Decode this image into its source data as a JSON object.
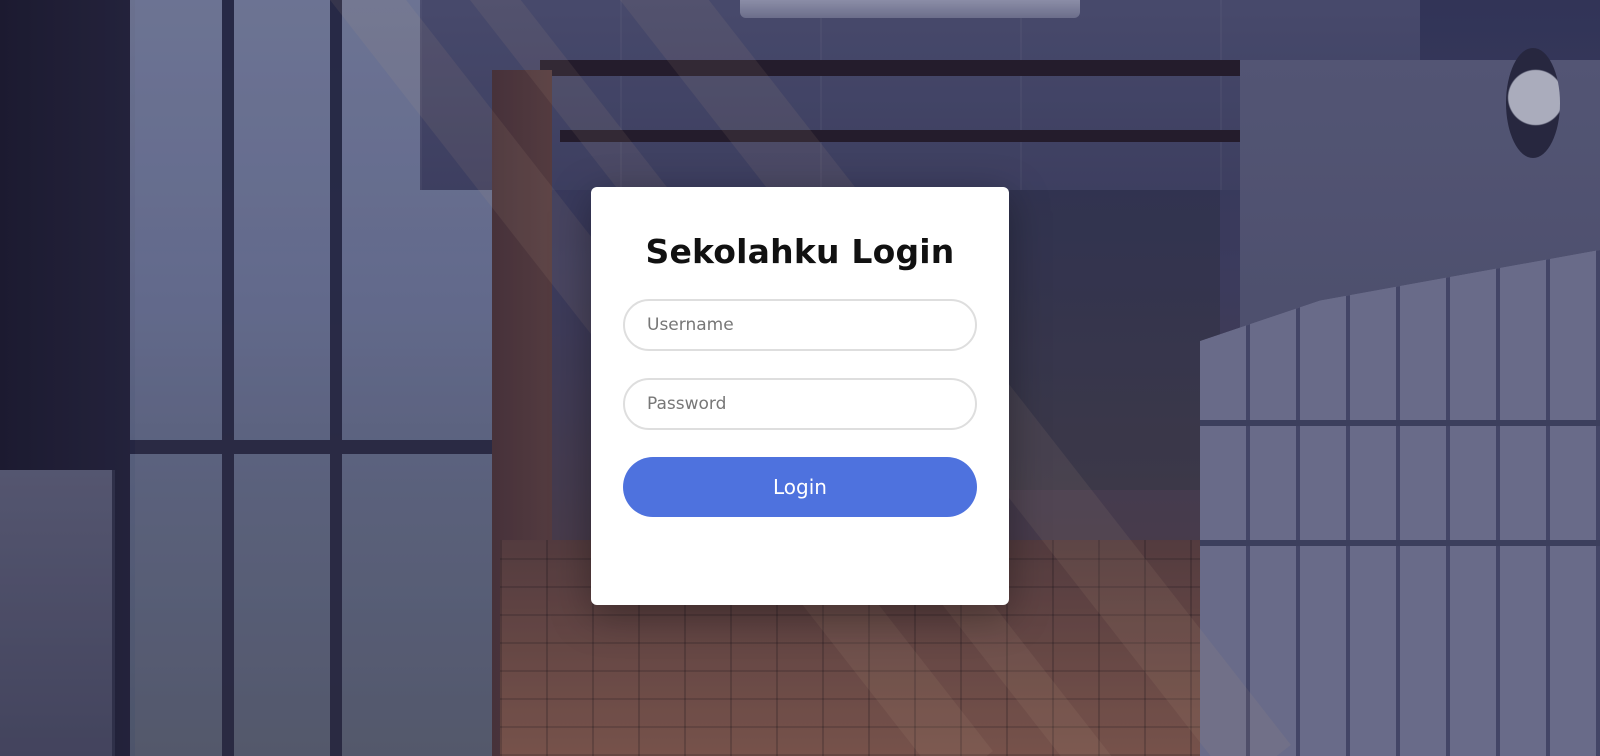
{
  "login": {
    "title": "Sekolahku Login",
    "username_placeholder": "Username",
    "password_placeholder": "Password",
    "button_label": "Login"
  },
  "colors": {
    "button": "#4e72de",
    "card": "#ffffff",
    "title": "#111111"
  }
}
